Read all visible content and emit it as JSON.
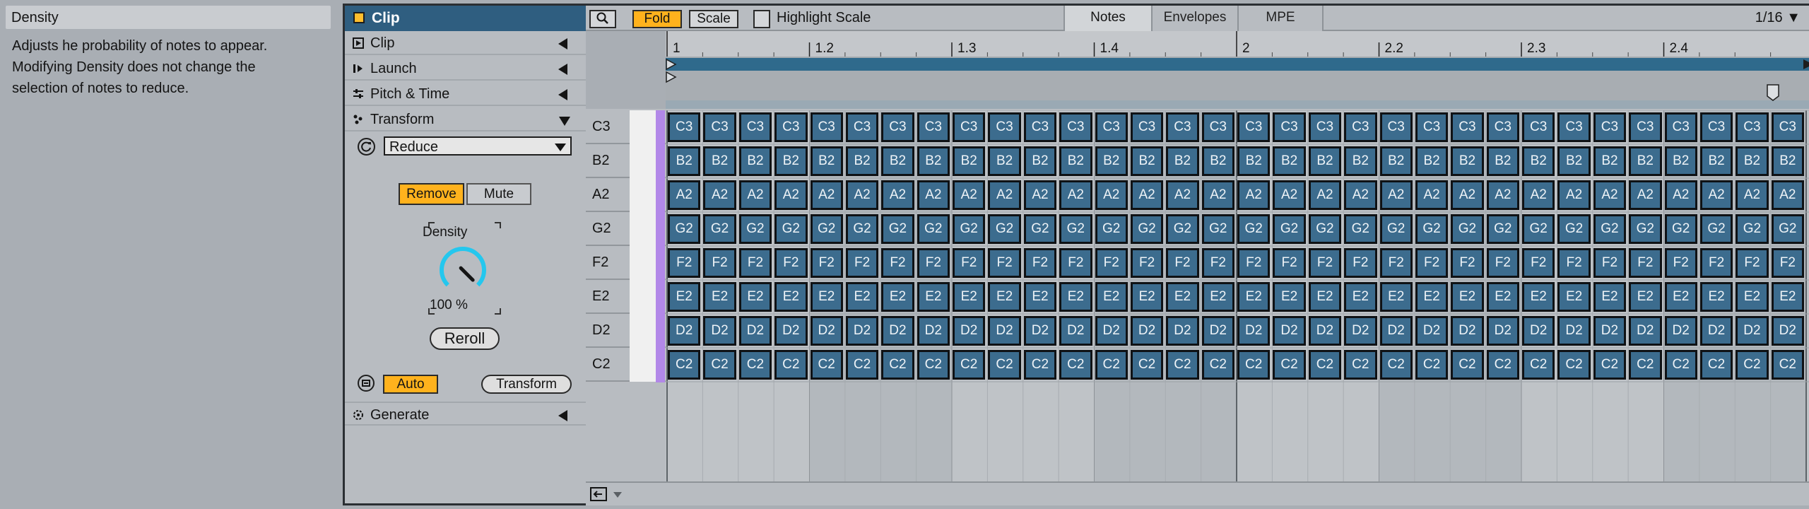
{
  "info": {
    "title": "Density",
    "body": "Adjusts he probability of notes to appear. Modifying Density does not change the selection of notes to reduce."
  },
  "panel": {
    "title": "Clip",
    "sections": {
      "clip": "Clip",
      "launch": "Launch",
      "pitch_time": "Pitch & Time",
      "transform": "Transform",
      "generate": "Generate"
    },
    "transform_mode": "Reduce",
    "remove_label": "Remove",
    "mute_label": "Mute",
    "density_label": "Density",
    "density_value": "100 %",
    "density_level": 1.0,
    "reroll_label": "Reroll",
    "auto_label": "Auto",
    "transform_button": "Transform"
  },
  "toolbar": {
    "fold": "Fold",
    "scale": "Scale",
    "highlight_scale": "Highlight Scale",
    "tabs": [
      "Notes",
      "Envelopes",
      "MPE"
    ],
    "grid": "1/16 ▼"
  },
  "ruler": {
    "labels": [
      "1",
      "1.2",
      "1.3",
      "1.4",
      "2",
      "2.2",
      "2.3",
      "2.4"
    ]
  },
  "pitches": [
    "C3",
    "B2",
    "A2",
    "G2",
    "F2",
    "E2",
    "D2",
    "C2"
  ],
  "notes_per_row": 32,
  "colors": {
    "accent": "#ffb21d",
    "clip_blue": "#2f5e80",
    "note": "#3c6c8e",
    "knob_ring": "#24c7ee",
    "key_strip": "#b288e8"
  }
}
